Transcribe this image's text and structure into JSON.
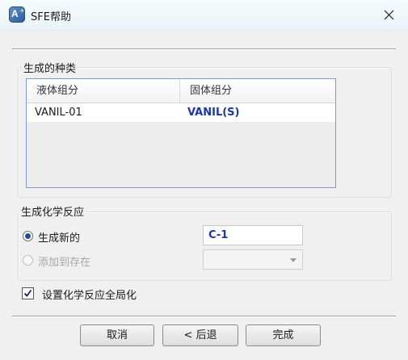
{
  "window": {
    "title": "SFE帮助",
    "icon_letter": "A",
    "icon_plus": "+"
  },
  "species_group": {
    "label": "生成的种类",
    "columns": [
      "液体组分",
      "固体组分"
    ],
    "rows": [
      {
        "liquid": "VANIL-01",
        "solid": "VANIL(S)"
      }
    ]
  },
  "reaction_group": {
    "label": "生成化学反应",
    "option_new": {
      "label": "生成新的",
      "selected": true
    },
    "option_existing": {
      "label": "添加到存在",
      "selected": false,
      "enabled": false
    },
    "new_name_value": "C-1",
    "existing_select_value": ""
  },
  "global_checkbox": {
    "label": "设置化学反应全局化",
    "checked": true
  },
  "buttons": {
    "cancel": "取消",
    "back": "< 后退",
    "finish": "完成"
  },
  "colors": {
    "accent_text": "#1534c8",
    "radio_dot": "#1a4fa3",
    "table_border": "#7a9dc4"
  }
}
